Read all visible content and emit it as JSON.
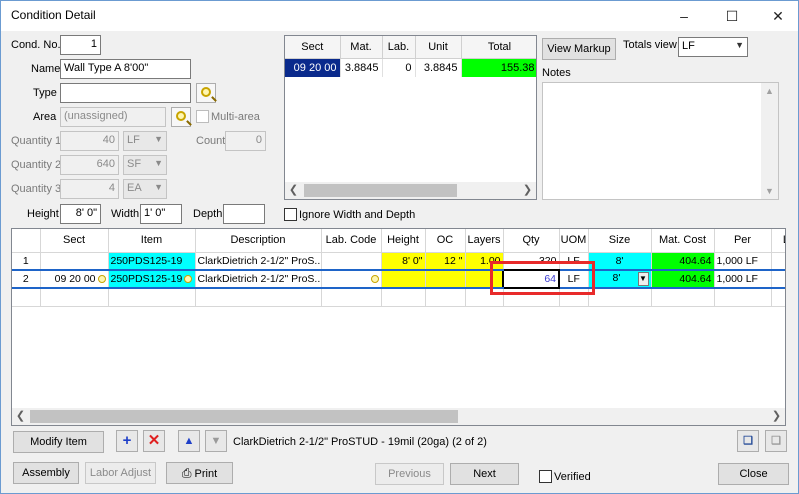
{
  "window": {
    "title": "Condition Detail"
  },
  "form": {
    "cond_no_label": "Cond. No.",
    "cond_no": "1",
    "name_label": "Name",
    "name": "Wall Type A 8'00\"",
    "type_label": "Type",
    "type": "",
    "area_label": "Area",
    "area_placeholder": "(unassigned)",
    "multi_area_label": "Multi-area",
    "quantity1_label": "Quantity 1",
    "quantity1": "40",
    "quantity1_unit": "LF",
    "count_label": "Count",
    "count": "0",
    "quantity2_label": "Quantity 2",
    "quantity2": "640",
    "quantity2_unit": "SF",
    "quantity3_label": "Quantity 3",
    "quantity3": "4",
    "quantity3_unit": "EA",
    "height_label": "Height",
    "height": "8' 0\"",
    "width_label": "Width",
    "width": "1' 0\"",
    "depth_label": "Depth",
    "depth": "",
    "ignore_label": "Ignore Width and Depth"
  },
  "summary_grid": {
    "headers": [
      "Sect",
      "Mat.",
      "Lab.",
      "Unit",
      "Total"
    ],
    "row": {
      "sect": "09 20 00",
      "mat": "3.8845",
      "lab": "0",
      "unit": "3.8845",
      "total": "155.38"
    }
  },
  "right_panel": {
    "view_markup": "View Markup",
    "totals_view_label": "Totals view",
    "totals_view_value": "LF",
    "notes_label": "Notes"
  },
  "main_grid": {
    "headers": [
      "Sect",
      "Item",
      "Description",
      "Lab. Code",
      "Height",
      "OC",
      "Layers",
      "Qty",
      "UOM",
      "Size",
      "Mat. Cost",
      "Per",
      "La"
    ],
    "rows": [
      {
        "num": "1",
        "sect": "",
        "item": "250PDS125-19",
        "desc": "ClarkDietrich 2-1/2\" ProS...",
        "labcode": "",
        "height": "8' 0\"",
        "oc": "12 \"",
        "layers": "1.00",
        "qty": "320",
        "uom": "LF",
        "size": "8'",
        "matcost": "404.64",
        "per": "1,000 LF"
      },
      {
        "num": "2",
        "sect": "09 20 00",
        "item": "250PDS125-19",
        "desc": "ClarkDietrich 2-1/2\" ProS...",
        "labcode": "",
        "height": "",
        "oc": "",
        "layers": "",
        "qty": "64",
        "uom": "LF",
        "size": "8'",
        "matcost": "404.64",
        "per": "1,000 LF"
      }
    ]
  },
  "toolbar": {
    "modify_item": "Modify Item",
    "status_text": "ClarkDietrich 2-1/2\" ProSTUD  - 19mil (20ga) (2 of 2)"
  },
  "footer": {
    "assembly": "Assembly",
    "labor_adjust": "Labor Adjust",
    "print": "Print",
    "previous": "Previous",
    "next": "Next",
    "verified": "Verified",
    "close": "Close"
  }
}
